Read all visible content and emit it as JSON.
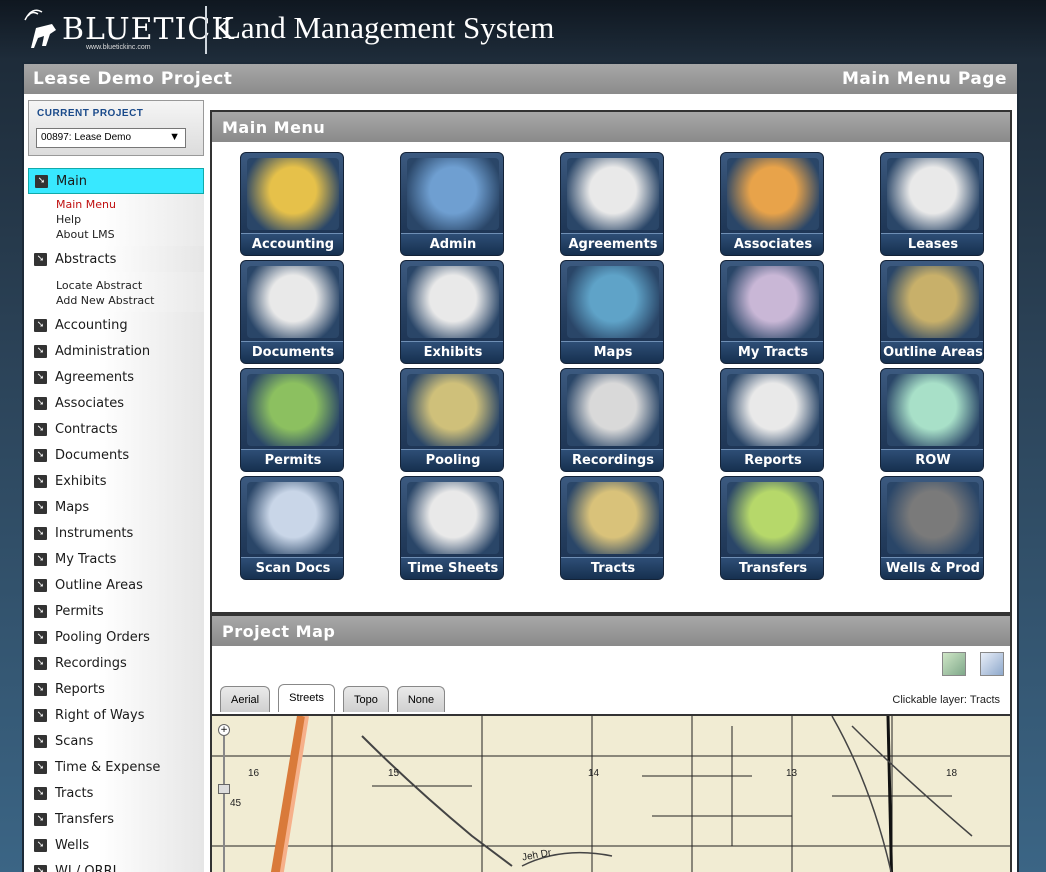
{
  "header": {
    "brand": "BLUETICK",
    "brand_url": "www.bluetickinc.com",
    "app_title": "Land Management System"
  },
  "titlebar": {
    "project": "Lease Demo Project",
    "page": "Main Menu Page"
  },
  "sidebar": {
    "current_project_label": "CURRENT PROJECT",
    "project_select_value": "00897: Lease Demo",
    "main": {
      "label": "Main",
      "subitems": [
        "Main Menu",
        "Help",
        "About LMS"
      ]
    },
    "abstracts": {
      "label": "Abstracts",
      "subitems": [
        "Locate Abstract",
        "Add New Abstract"
      ]
    },
    "items": [
      "Accounting",
      "Administration",
      "Agreements",
      "Associates",
      "Contracts",
      "Documents",
      "Exhibits",
      "Maps",
      "Instruments",
      "My Tracts",
      "Outline Areas",
      "Permits",
      "Pooling Orders",
      "Recordings",
      "Reports",
      "Right of Ways",
      "Scans",
      "Time & Expense",
      "Tracts",
      "Transfers",
      "Wells",
      "WI / ORRI"
    ]
  },
  "main_menu": {
    "title": "Main Menu",
    "tiles": [
      {
        "label": "Accounting",
        "icon": "money-bag-icon",
        "color": "#e6c14a"
      },
      {
        "label": "Admin",
        "icon": "folder-keys-icon",
        "color": "#6f9fd1"
      },
      {
        "label": "Agreements",
        "icon": "agree-document-icon",
        "color": "#e9e9e9"
      },
      {
        "label": "Associates",
        "icon": "handshake-icon",
        "color": "#e8a34a"
      },
      {
        "label": "Leases",
        "icon": "lease-document-icon",
        "color": "#e9e9e9"
      },
      {
        "label": "Documents",
        "icon": "doc-tags-icon",
        "color": "#e9e9e9"
      },
      {
        "label": "Exhibits",
        "icon": "list-document-icon",
        "color": "#e9e9e9"
      },
      {
        "label": "Maps",
        "icon": "map-layers-icon",
        "color": "#5fa3c8"
      },
      {
        "label": "My Tracts",
        "icon": "user-map-icon",
        "color": "#c9b7d6"
      },
      {
        "label": "Outline Areas",
        "icon": "outline-map-icon",
        "color": "#c8b06a"
      },
      {
        "label": "Permits",
        "icon": "permit-document-icon",
        "color": "#8cc060"
      },
      {
        "label": "Pooling",
        "icon": "pooling-map-icon",
        "color": "#cfc07a"
      },
      {
        "label": "Recordings",
        "icon": "record-building-icon",
        "color": "#d9d9d9"
      },
      {
        "label": "Reports",
        "icon": "report-chart-icon",
        "color": "#e9e9e9"
      },
      {
        "label": "ROW",
        "icon": "row-arrows-icon",
        "color": "#a8e0c8"
      },
      {
        "label": "Scan Docs",
        "icon": "scanner-icon",
        "color": "#c9d6e8"
      },
      {
        "label": "Time Sheets",
        "icon": "invoice-icon",
        "color": "#e9e9e9"
      },
      {
        "label": "Tracts",
        "icon": "tracts-map-icon",
        "color": "#d9c27a"
      },
      {
        "label": "Transfers",
        "icon": "transfer-arrows-icon",
        "color": "#b6d86a"
      },
      {
        "label": "Wells & Prod",
        "icon": "oil-well-icon",
        "color": "#7a7a7a"
      }
    ]
  },
  "project_map": {
    "title": "Project Map",
    "tabs": [
      "Aerial",
      "Streets",
      "Topo",
      "None"
    ],
    "active_tab": "Streets",
    "clickable_layer": "Clickable layer: Tracts",
    "section_labels": [
      "16",
      "15",
      "14",
      "13",
      "18",
      "45"
    ],
    "road_label": "Jeh Dr"
  }
}
